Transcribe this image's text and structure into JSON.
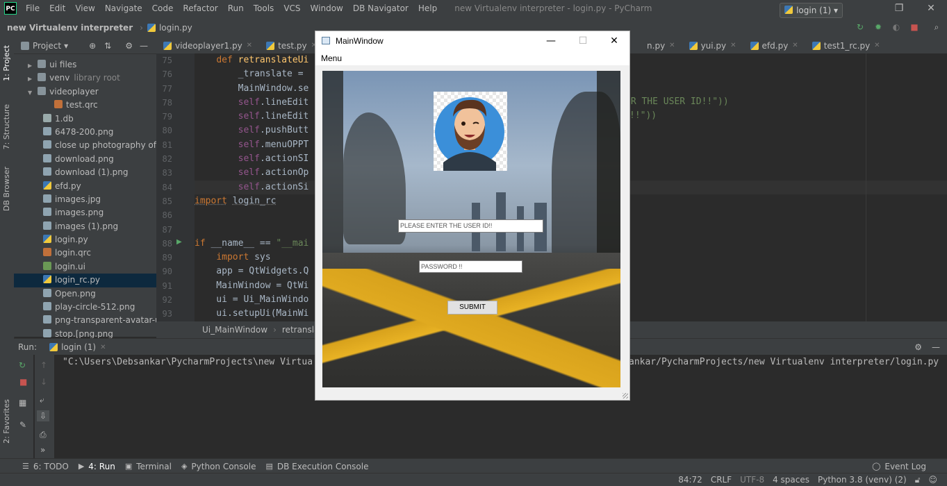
{
  "ide": {
    "app_logo": "PC",
    "menu": [
      "File",
      "Edit",
      "View",
      "Navigate",
      "Code",
      "Refactor",
      "Run",
      "Tools",
      "VCS",
      "Window",
      "DB Navigator",
      "Help"
    ],
    "window_title": "new Virtualenv interpreter - login.py - PyCharm",
    "breadcrumb": {
      "project": "new Virtualenv interpreter",
      "file": "login.py"
    },
    "run_config": "login (1)",
    "left_vtabs": [
      "1: Project",
      "7: Structure",
      "DB Browser",
      "2: Favorites"
    ]
  },
  "project_panel": {
    "title": "Project",
    "items": [
      {
        "label": "ui files",
        "indent": 1,
        "icon": "folder-icon",
        "arrow": "▶"
      },
      {
        "label": "venv",
        "suffix": "library root",
        "indent": 1,
        "icon": "folder-icon",
        "arrow": "▶"
      },
      {
        "label": "videoplayer",
        "indent": 1,
        "icon": "folder-icon",
        "arrow": "▼"
      },
      {
        "label": "test.qrc",
        "indent": 2,
        "icon": "qrc-file-icon"
      },
      {
        "label": "1.db",
        "indent": 1,
        "icon": "db-file-icon"
      },
      {
        "label": "6478-200.png",
        "indent": 1,
        "icon": "image-file-icon"
      },
      {
        "label": "close up photography of r",
        "indent": 1,
        "icon": "image-file-icon"
      },
      {
        "label": "download.png",
        "indent": 1,
        "icon": "image-file-icon"
      },
      {
        "label": "download (1).png",
        "indent": 1,
        "icon": "image-file-icon"
      },
      {
        "label": "efd.py",
        "indent": 1,
        "icon": "python-file-icon"
      },
      {
        "label": "images.jpg",
        "indent": 1,
        "icon": "image-file-icon"
      },
      {
        "label": "images.png",
        "indent": 1,
        "icon": "image-file-icon"
      },
      {
        "label": "images (1).png",
        "indent": 1,
        "icon": "image-file-icon"
      },
      {
        "label": "login.py",
        "indent": 1,
        "icon": "python-file-icon"
      },
      {
        "label": "login.qrc",
        "indent": 1,
        "icon": "qrc-file-icon"
      },
      {
        "label": "login.ui",
        "indent": 1,
        "icon": "ui-file-icon"
      },
      {
        "label": "login_rc.py",
        "indent": 1,
        "icon": "python-file-icon",
        "selected": true
      },
      {
        "label": "Open.png",
        "indent": 1,
        "icon": "image-file-icon"
      },
      {
        "label": "play-circle-512.png",
        "indent": 1,
        "icon": "image-file-icon"
      },
      {
        "label": "png-transparent-avatar-use",
        "indent": 1,
        "icon": "image-file-icon"
      },
      {
        "label": "stop.[png.png",
        "indent": 1,
        "icon": "image-file-icon"
      }
    ]
  },
  "editor": {
    "tabs": [
      "videoplayer1.py",
      "test.py",
      "n.py",
      "yui.py",
      "efd.py",
      "test1_rc.py"
    ],
    "line_numbers": [
      "75",
      "76",
      "77",
      "78",
      "79",
      "80",
      "81",
      "82",
      "83",
      "84",
      "85",
      "86",
      "87",
      "88",
      "89",
      "90",
      "91",
      "92",
      "93"
    ],
    "right_fragments": {
      "line78": "ER THE USER ID!!\"))",
      "line79": "!!\"))"
    },
    "breadcrumb": [
      "Ui_MainWindow",
      "retranslat"
    ]
  },
  "run_panel": {
    "label": "Run:",
    "tab": "login (1)",
    "console_left": "\"C:\\Users\\Debsankar\\PycharmProjects\\new Virtua",
    "console_right": "ankar/PycharmProjects/new Virtualenv interpreter/login.py"
  },
  "bottom_tabs": [
    "6: TODO",
    "4: Run",
    "Terminal",
    "Python Console",
    "DB Execution Console",
    "Event Log"
  ],
  "status_bar": {
    "position": "84:72",
    "line_sep": "CRLF",
    "encoding": "UTF-8",
    "indent": "4 spaces",
    "interpreter": "Python 3.8 (venv) (2)"
  },
  "qt_window": {
    "title": "MainWindow",
    "menu": "Menu",
    "user_placeholder": "PLEASE ENTER THE USER ID!!",
    "password_placeholder": "PASSWORD !!",
    "submit": "SUBMIT"
  }
}
